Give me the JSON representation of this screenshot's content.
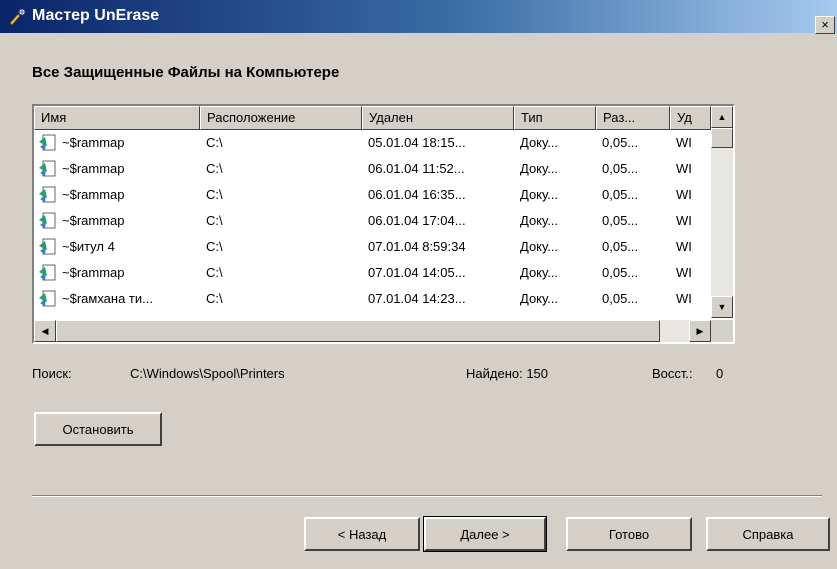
{
  "window": {
    "title": "Мастер UnErase",
    "close_label": "×"
  },
  "heading": "Все Защищенные Файлы на Компьютере",
  "table": {
    "columns": [
      "Имя",
      "Расположение",
      "Удален",
      "Тип",
      "Раз...",
      "Уд"
    ],
    "rows": [
      {
        "name": "~$rammap",
        "location": "C:\\",
        "deleted": "05.01.04 18:15...",
        "type": "Доку...",
        "size": "0,05...",
        "by": "WI"
      },
      {
        "name": "~$rammap",
        "location": "C:\\",
        "deleted": "06.01.04 11:52...",
        "type": "Доку...",
        "size": "0,05...",
        "by": "WI"
      },
      {
        "name": "~$rammap",
        "location": "C:\\",
        "deleted": "06.01.04 16:35...",
        "type": "Доку...",
        "size": "0,05...",
        "by": "WI"
      },
      {
        "name": "~$rammap",
        "location": "C:\\",
        "deleted": "06.01.04 17:04...",
        "type": "Доку...",
        "size": "0,05...",
        "by": "WI"
      },
      {
        "name": "~$итул 4",
        "location": "C:\\",
        "deleted": "07.01.04 8:59:34",
        "type": "Доку...",
        "size": "0,05...",
        "by": "WI"
      },
      {
        "name": "~$rammap",
        "location": "C:\\",
        "deleted": "07.01.04 14:05...",
        "type": "Доку...",
        "size": "0,05...",
        "by": "WI"
      },
      {
        "name": "~$rамхана ти...",
        "location": "C:\\",
        "deleted": "07.01.04 14:23...",
        "type": "Доку...",
        "size": "0,05...",
        "by": "WI"
      }
    ]
  },
  "status": {
    "search_label": "Поиск:",
    "search_path": "C:\\Windows\\Spool\\Printers",
    "found_label": "Найдено: 150",
    "restored_label": "Восст.:",
    "restored_value": "0"
  },
  "buttons": {
    "stop": "Остановить",
    "back": "< Назад",
    "next": "Далее >",
    "finish": "Готово",
    "help": "Справка"
  },
  "colors": {
    "face": "#d4d0c8",
    "titlebar_start": "#0a246a",
    "titlebar_end": "#a6caf0"
  }
}
